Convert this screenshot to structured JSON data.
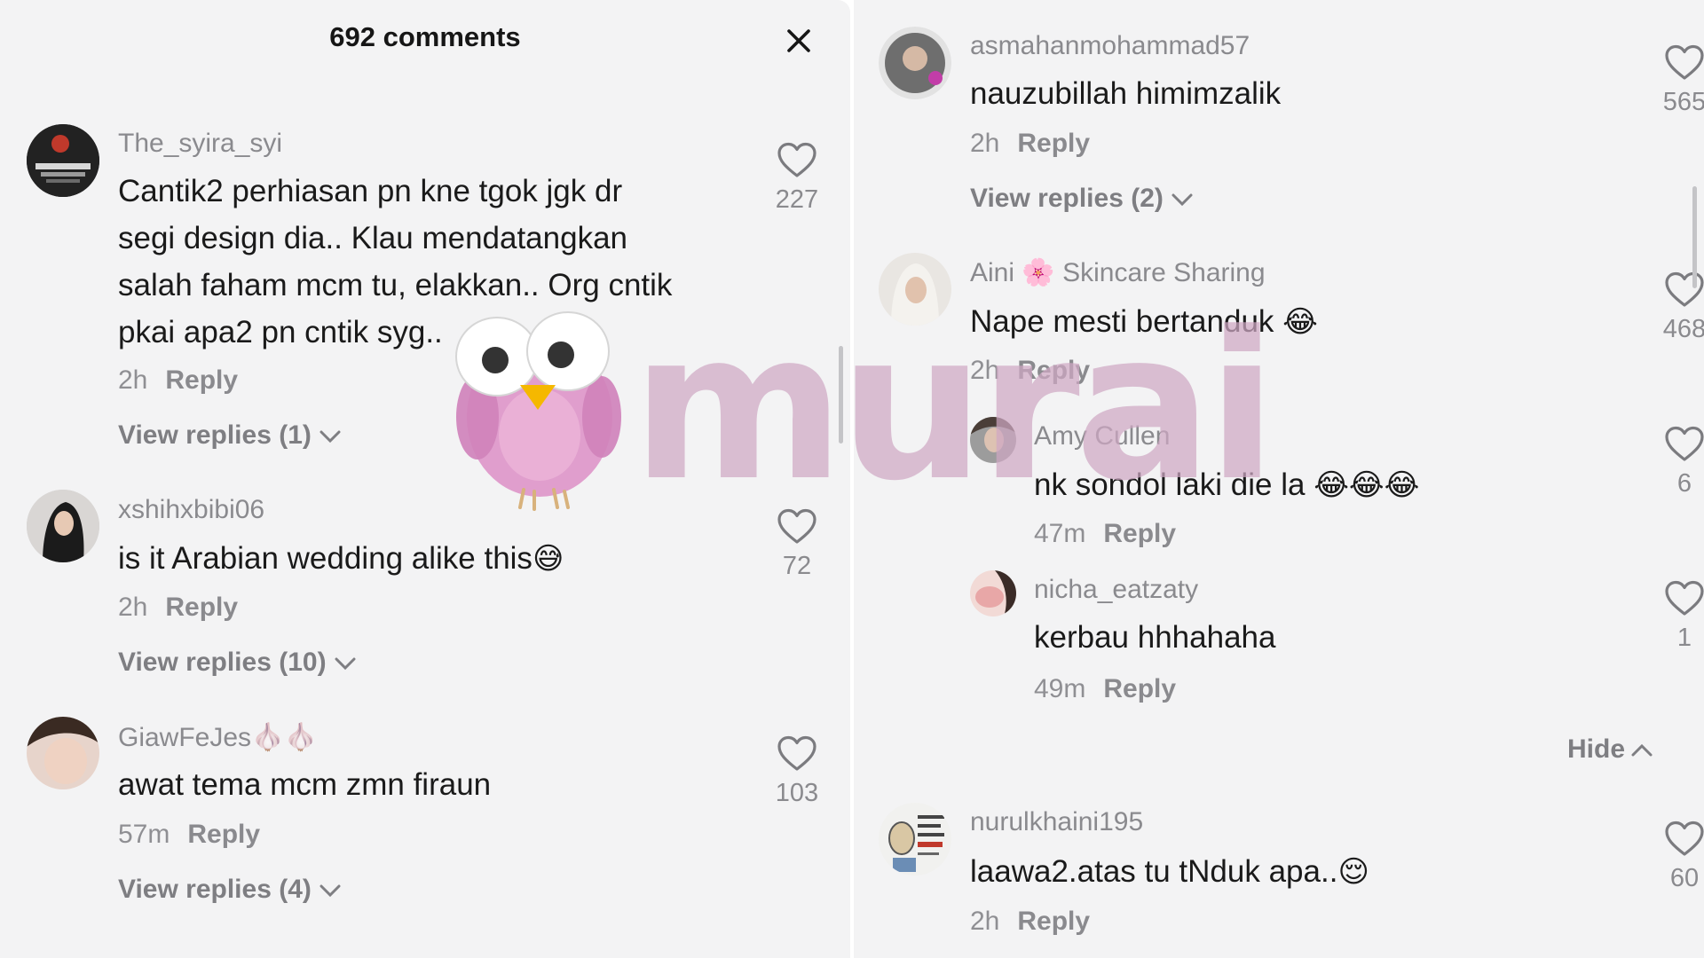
{
  "left": {
    "header": {
      "title": "692 comments"
    },
    "comments": [
      {
        "username": "The_syira_syi",
        "lines": [
          "Cantik2 perhiasan pn kne tgok jgk dr",
          "segi design dia.. Klau mendatangkan",
          "salah faham mcm tu, elakkan.. Org cntik",
          "pkai apa2 pn cntik syg.."
        ],
        "time": "2h",
        "reply": "Reply",
        "likes": "227",
        "view_replies": "View replies (1)"
      },
      {
        "username": "xshihxbibi06",
        "lines": [
          "is it Arabian wedding alike this"
        ],
        "emoji": "😅",
        "time": "2h",
        "reply": "Reply",
        "likes": "72",
        "view_replies": "View replies (10)"
      },
      {
        "username": "GiawFeJes",
        "username_emoji": "🧄🧄",
        "lines": [
          "awat tema mcm zmn firaun"
        ],
        "time": "57m",
        "reply": "Reply",
        "likes": "103",
        "view_replies": "View replies (4)"
      }
    ]
  },
  "right": {
    "comments": [
      {
        "username": "asmahanmohammad57",
        "text": "nauzubillah himimzalik",
        "time": "2h",
        "reply": "Reply",
        "likes": "565",
        "view_replies": "View replies (2)"
      },
      {
        "username": "Aini",
        "username_emoji": "🌸",
        "username_suffix": "Skincare Sharing",
        "text": "Nape mesti bertanduk",
        "emoji": "😂",
        "time": "2h",
        "reply": "Reply",
        "likes": "468",
        "replies": [
          {
            "username": "Amy Cullen",
            "text": "nk sondol laki die la",
            "emoji": "😂😂😂",
            "time": "47m",
            "reply": "Reply",
            "likes": "6"
          },
          {
            "username": "nicha_eatzaty",
            "text": "kerbau hhhahaha",
            "time": "49m",
            "reply": "Reply",
            "likes": "1"
          }
        ],
        "hide": "Hide"
      },
      {
        "username": "nurulkhaini195",
        "text": "laawa2.atas tu tNduk apa..",
        "emoji": "😌",
        "time": "2h",
        "reply": "Reply",
        "likes": "60"
      }
    ]
  },
  "watermark": {
    "text": "murai"
  },
  "icons": {
    "close": "close-icon",
    "like": "heart-icon",
    "expand": "chevron-down-icon",
    "collapse": "chevron-up-icon"
  },
  "colors": {
    "background": "#f3f3f4",
    "text": "#1a1a1a",
    "muted": "#8a8a8e",
    "watermark": "#cea8c4"
  }
}
